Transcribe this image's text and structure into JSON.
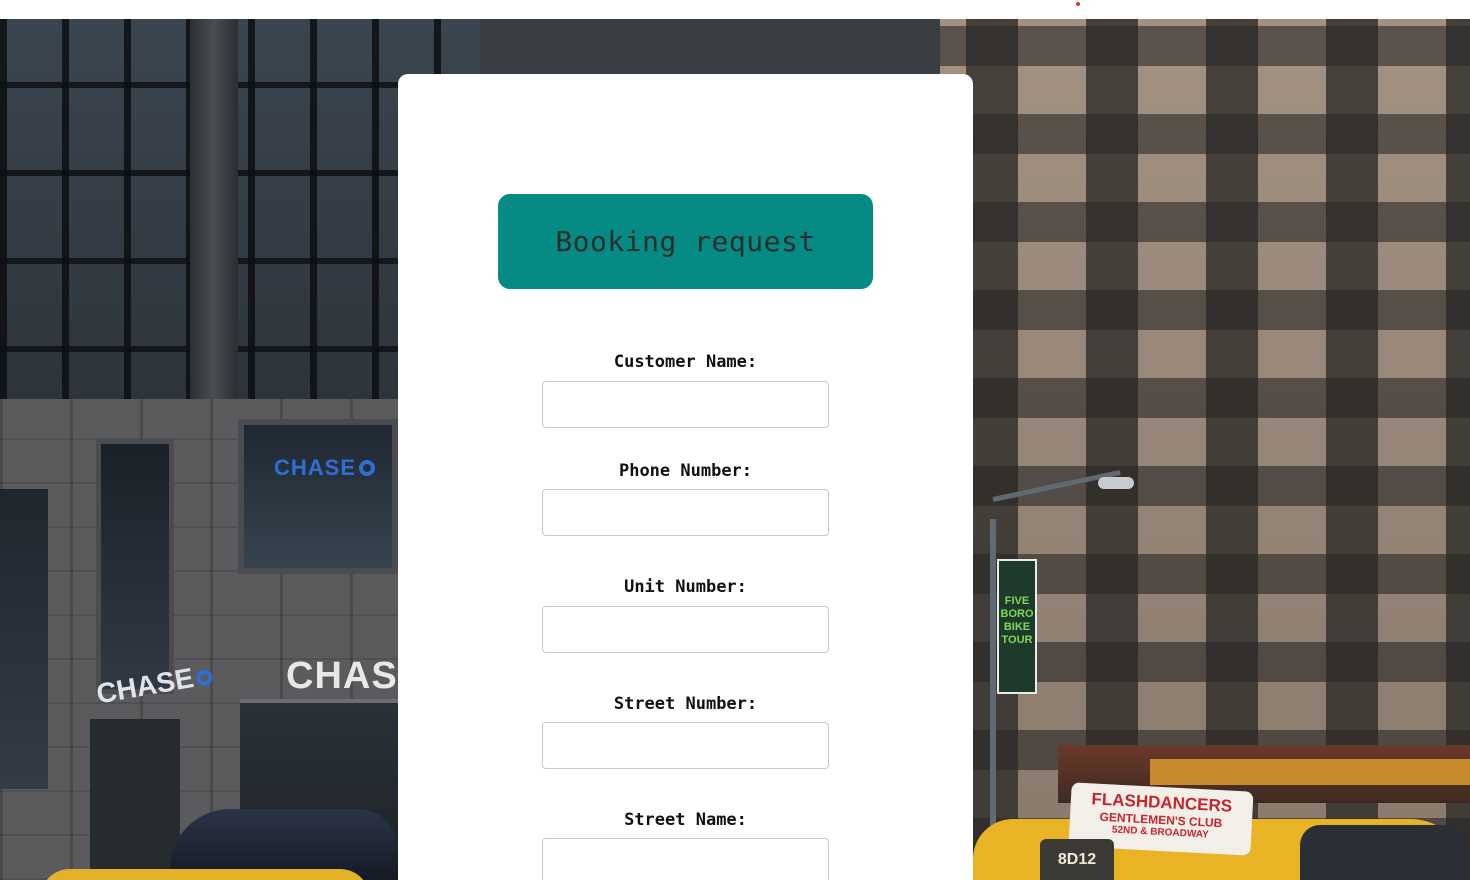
{
  "form": {
    "title": "Booking request",
    "fields": [
      {
        "label": "Customer Name:",
        "value": "",
        "placeholder": ""
      },
      {
        "label": "Phone Number:",
        "value": "",
        "placeholder": ""
      },
      {
        "label": "Unit Number:",
        "value": "",
        "placeholder": ""
      },
      {
        "label": "Street Number:",
        "value": "",
        "placeholder": ""
      },
      {
        "label": "Street Name:",
        "value": "",
        "placeholder": ""
      }
    ]
  },
  "background": {
    "signs": {
      "chase_upper": "CHASE",
      "chase_main": "CHAS",
      "chase_side": "CHASE",
      "banner_lines": [
        "FIVE",
        "BORO",
        "BIKE",
        "TOUR"
      ],
      "taxi_ad_line1": "FLASHDANCERS",
      "taxi_ad_line2": "GENTLEMEN'S CLUB",
      "taxi_ad_line3": "52ND & BROADWAY",
      "taxi_medallion": "8D12"
    }
  },
  "colors": {
    "title_bg": "#058a84",
    "title_text": "#2a2f2e",
    "card_bg": "#ffffff",
    "input_border": "#c8c8c8",
    "top_dot": "#e0331f"
  }
}
